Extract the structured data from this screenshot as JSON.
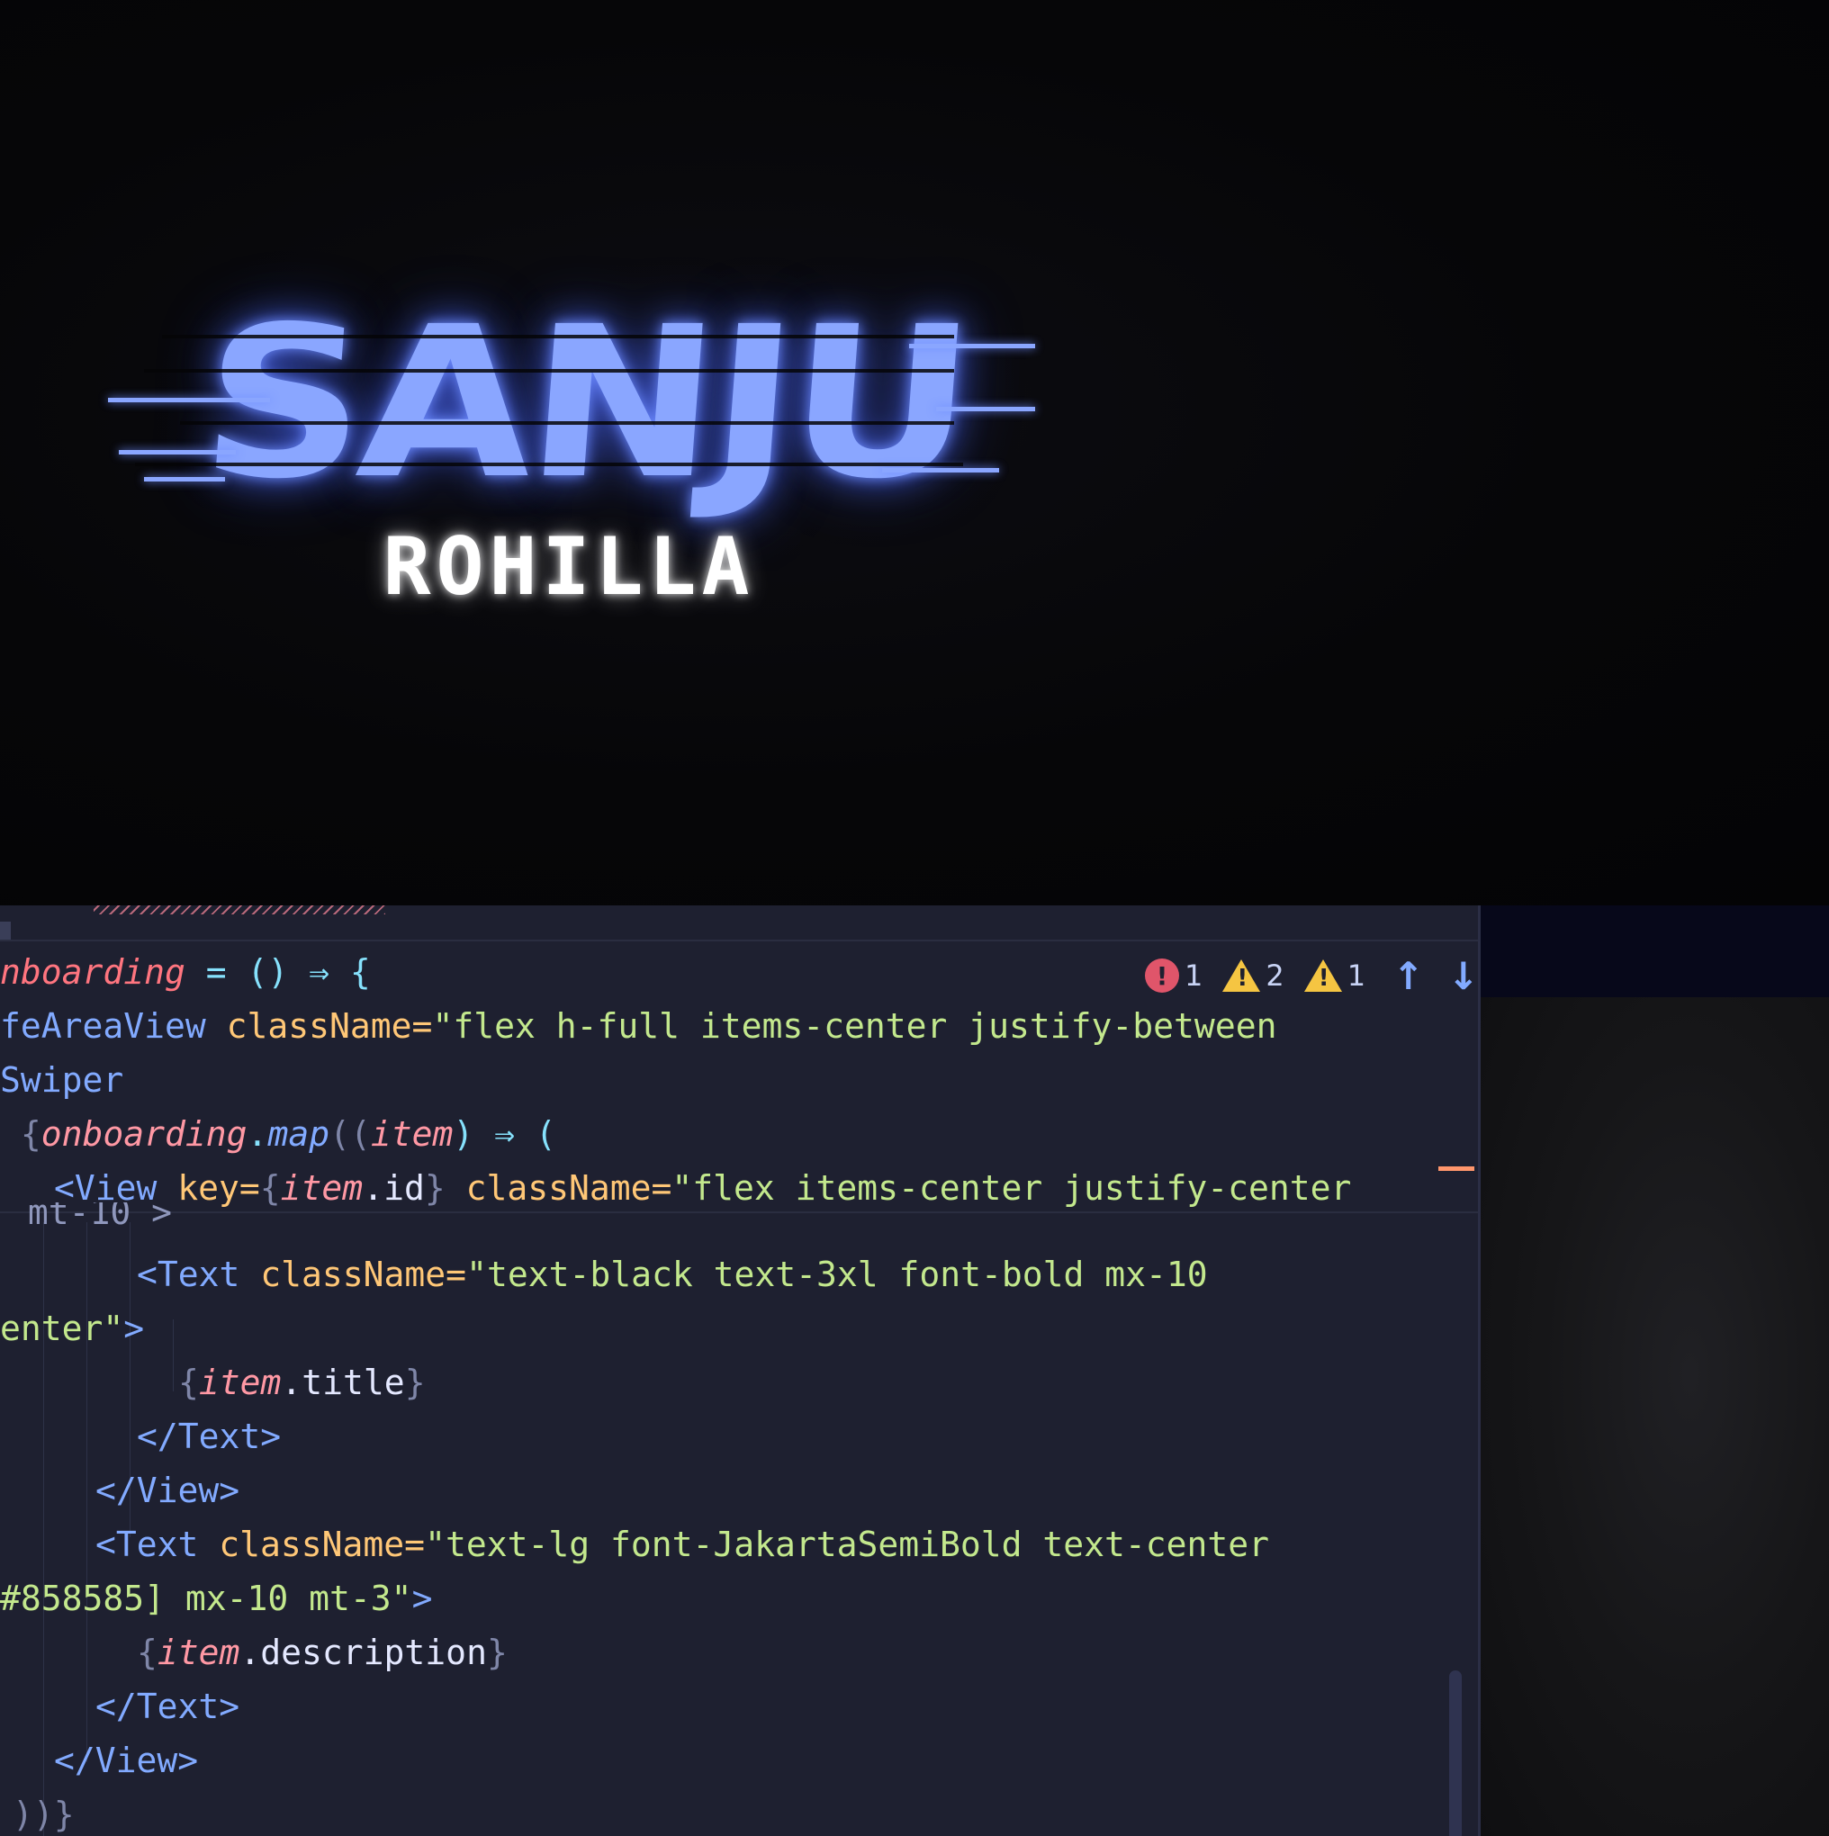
{
  "title_card": {
    "main_text": "SANJU",
    "sub_text": "ROHILLA",
    "accent_color": "#8aa6ff"
  },
  "editor": {
    "diagnostics": {
      "errors": "1",
      "warnings": "2",
      "infos": "1"
    },
    "lines": {
      "l1": {
        "a": "nboarding",
        "b": " = () ⇒ {"
      },
      "l2": {
        "a": "feAreaView",
        "b": " className=",
        "c": "\"flex h-full items-center justify-between"
      },
      "l3": {
        "a": "Swiper"
      },
      "l4": {
        "a": " {",
        "b": "onboarding",
        "c": ".",
        "d": "map",
        "e": "((",
        "f": "item",
        "g": ") ⇒ ("
      },
      "l5": {
        "a": "<View",
        "b": " key=",
        "c": "{",
        "d": "item",
        "e": ".id",
        "f": "}",
        "g": " className=",
        "h": "\"flex items-center justify-center"
      },
      "l5_wrap": {
        "a": " mt-10 >"
      },
      "l6": {
        "a": "<Text",
        "b": " className=",
        "c": "\"text-black text-3xl font-bold mx-10"
      },
      "l7": {
        "a": "enter\"",
        "b": ">"
      },
      "l8": {
        "a": "{",
        "b": "item",
        "c": ".title",
        "d": "}"
      },
      "l9": {
        "a": "</Text>"
      },
      "l10": {
        "a": "</View>"
      },
      "l11": {
        "a": "<Text",
        "b": " className=",
        "c": "\"text-lg font-JakartaSemiBold text-center"
      },
      "l12": {
        "a": "#858585] mx-10 mt-3\"",
        "b": ">"
      },
      "l13": {
        "a": "{",
        "b": "item",
        "c": ".description",
        "d": "}"
      },
      "l14": {
        "a": "</Text>"
      },
      "l15": {
        "a": "</View>"
      },
      "l16": {
        "a": "))}"
      }
    }
  }
}
